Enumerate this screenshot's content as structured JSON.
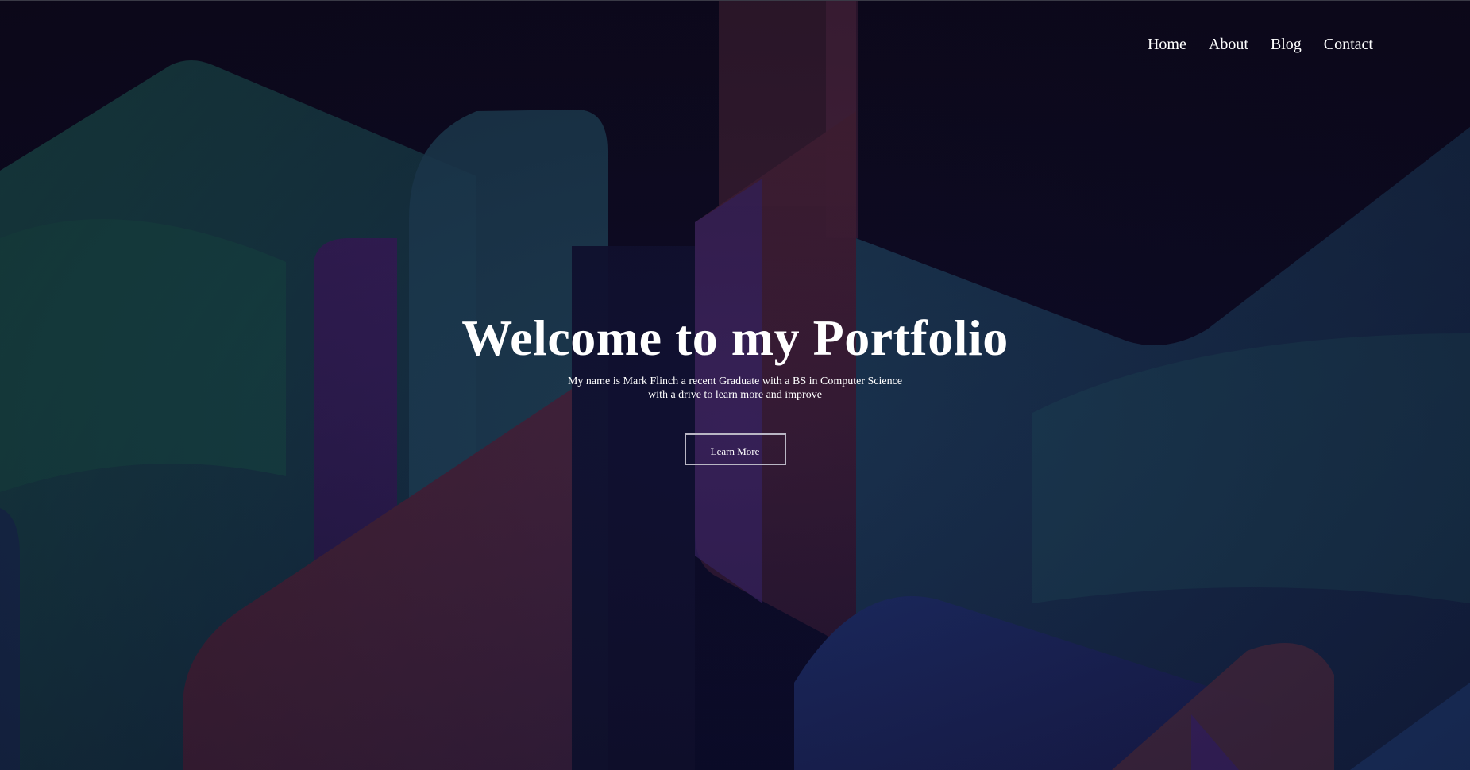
{
  "nav": {
    "items": [
      {
        "label": "Home"
      },
      {
        "label": "About"
      },
      {
        "label": "Blog"
      },
      {
        "label": "Contact"
      }
    ]
  },
  "hero": {
    "title": "Welcome to my Portfolio",
    "subtitle_line1": "My name is Mark Flinch a recent Graduate with a BS in Computer Science",
    "subtitle_line2": "with a drive to learn more and improve",
    "cta_label": "Learn More"
  },
  "colors": {
    "background": "#0c0a1d",
    "teal": "#1d4a57",
    "purple": "#3a2160",
    "rust": "#4a2a3a",
    "text": "#ffffff"
  }
}
